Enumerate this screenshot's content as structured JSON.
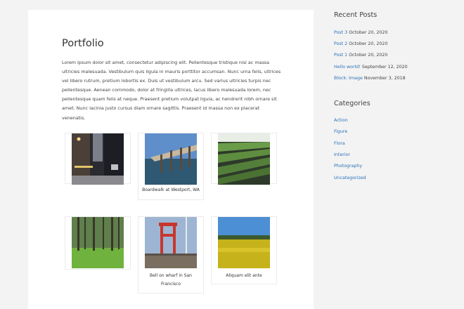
{
  "page": {
    "title": "Portfolio",
    "body": "Lorem ipsum dolor sit amet, consectetur adipiscing elit. Pellentesque tristique nisi ac massa ultricies malesuada. Vestibulum quis ligula in mauris porttitor accumsan. Nunc urna felis, ultrices vel libero rutrum, pretium lobortis ex. Duis ut vestibulum arcu. Sed varius ultricies turpis nec pellentesque. Aenean commodo, dolor at fringilla ultrices, lacus libero malesuada lorem, nec pellentesque quam felis at neque. Praesent pretium volutpat ligula, ac hendrerit nibh ornare sit amet. Nunc lacinia justo cursus diam ornare sagittis. Praesent id massa non ex placerat venenatis."
  },
  "gallery": [
    {
      "caption": "",
      "scene": "city-street"
    },
    {
      "caption": "Boardwalk at Westport, WA",
      "scene": "boardwalk"
    },
    {
      "caption": "",
      "scene": "nursery-rows"
    },
    {
      "caption": "",
      "scene": "pine-forest"
    },
    {
      "caption": "Bell on wharf in San Francisco",
      "scene": "wharf-bell"
    },
    {
      "caption": "Aliquam elit ante",
      "scene": "yellow-field"
    }
  ],
  "sidebar": {
    "recent_title": "Recent Posts",
    "recent": [
      {
        "title": "Post 3",
        "date": "October 20, 2020"
      },
      {
        "title": "Post 2",
        "date": "October 20, 2020"
      },
      {
        "title": "Post 1",
        "date": "October 20, 2020"
      },
      {
        "title": "Hello world!",
        "date": "September 12, 2020"
      },
      {
        "title": "Block: Image",
        "date": "November 3, 2018"
      }
    ],
    "categories_title": "Categories",
    "categories": [
      "Action",
      "Figure",
      "Flora",
      "Interior",
      "Photography",
      "Uncategorized"
    ]
  },
  "colors": {
    "link": "#2d72b8",
    "background": "#f3f3f3",
    "panel": "#ffffff"
  }
}
